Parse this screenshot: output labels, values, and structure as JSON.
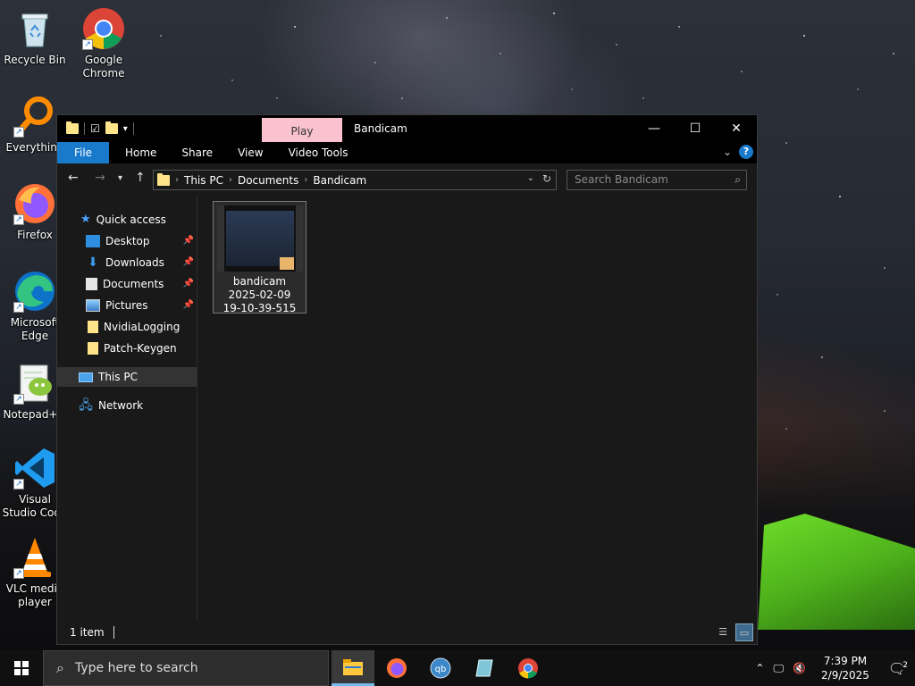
{
  "desktop": {
    "icons": [
      {
        "label": "Recycle Bin"
      },
      {
        "label": "Google Chrome"
      },
      {
        "label": "Everything"
      },
      {
        "label": "Firefox"
      },
      {
        "label": "Microsoft Edge"
      },
      {
        "label": "Notepad++"
      },
      {
        "label": "Visual Studio Code"
      },
      {
        "label": "VLC media player"
      }
    ]
  },
  "explorer": {
    "title": "Bandicam",
    "contextual_tab": "Play",
    "ribbon_tabs": [
      "File",
      "Home",
      "Share",
      "View",
      "Video Tools"
    ],
    "breadcrumb": [
      "This PC",
      "Documents",
      "Bandicam"
    ],
    "search_placeholder": "Search Bandicam",
    "nav": {
      "quick_access": "Quick access",
      "pinned": [
        "Desktop",
        "Downloads",
        "Documents",
        "Pictures"
      ],
      "folders": [
        "NvidiaLogging",
        "Patch-Keygen"
      ],
      "this_pc": "This PC",
      "network": "Network"
    },
    "file": {
      "line1": "bandicam",
      "line2": "2025-02-09",
      "line3": "19-10-39-515"
    },
    "status": "1 item"
  },
  "taskbar": {
    "search_placeholder": "Type here to search",
    "time": "7:39 PM",
    "date": "2/9/2025",
    "notification_count": "2"
  },
  "colors": {
    "accent": "#1979ca",
    "play_tab": "#f9c2ce",
    "folder": "#ffe48a"
  }
}
